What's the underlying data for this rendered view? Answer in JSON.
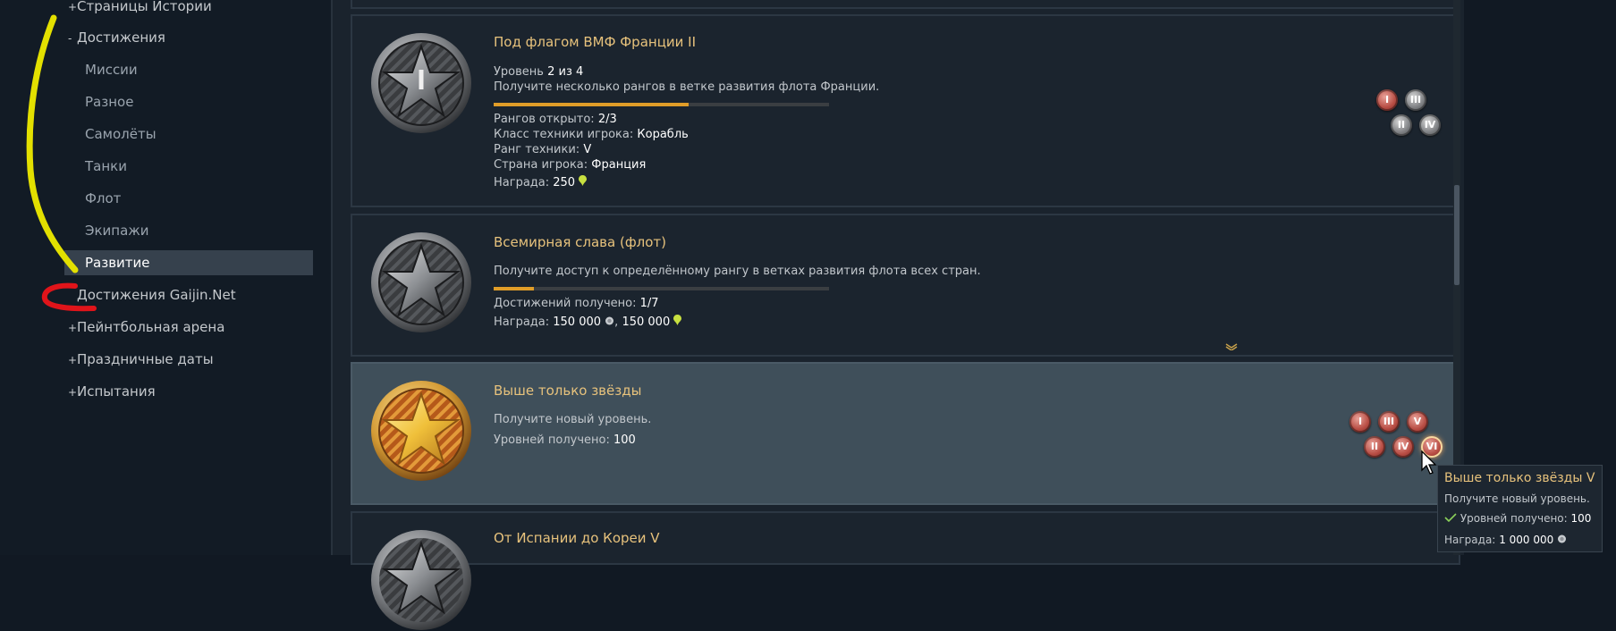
{
  "sidebar": {
    "items": [
      {
        "prefix": "+",
        "label": "Страницы Истории"
      },
      {
        "prefix": "-",
        "label": "Достижения"
      },
      {
        "label": "Миссии"
      },
      {
        "label": "Разное"
      },
      {
        "label": "Самолёты"
      },
      {
        "label": "Танки"
      },
      {
        "label": "Флот"
      },
      {
        "label": "Экипажи"
      },
      {
        "label": "Развитие"
      },
      {
        "label": "Достижения Gaijin.Net"
      },
      {
        "prefix": "+",
        "label": "Пейнтбольная арена"
      },
      {
        "prefix": "+",
        "label": "Праздничные даты"
      },
      {
        "prefix": "+",
        "label": "Испытания"
      }
    ],
    "active_index": 8
  },
  "cards": [
    {
      "title": "Под флагом ВМФ Франции II",
      "level_label": "Уровень",
      "level_value": "2 из 4",
      "description": "Получите несколько рангов в ветке развития флота Франции.",
      "progress": 0.58,
      "details": [
        {
          "label": "Рангов открыто:",
          "value": "2/3"
        },
        {
          "label": "Класс техники игрока:",
          "value": "Корабль"
        },
        {
          "label": "Ранг техники:",
          "value": "V"
        },
        {
          "label": "Страна игрока:",
          "value": "Франция"
        }
      ],
      "reward_label": "Награда:",
      "reward_value": "250",
      "ranks": [
        "I",
        "III",
        "II",
        "IV"
      ]
    },
    {
      "title": "Всемирная слава (флот)",
      "description": "Получите доступ к определённому рангу в ветках развития флота всех стран.",
      "progress": 0.12,
      "details": [
        {
          "label": "Достижений получено:",
          "value": "1/7"
        }
      ],
      "reward_label": "Награда:",
      "reward_value_1": "150 000",
      "reward_separator": ",",
      "reward_value_2": "150 000"
    },
    {
      "title": "Выше только звёзды",
      "description": "Получите новый уровень.",
      "details": [
        {
          "label": "Уровней получено:",
          "value": "100"
        }
      ],
      "ranks": [
        "I",
        "III",
        "V",
        "II",
        "IV",
        "VI"
      ]
    },
    {
      "title": "От Испании до Кореи V"
    }
  ],
  "tooltip": {
    "title": "Выше только звёзды V",
    "description": "Получите новый уровень.",
    "check_label": "Уровней получено:",
    "check_value": "100",
    "reward_label": "Награда:",
    "reward_value": "1 000 000"
  },
  "colors": {
    "title": "#e7c27c",
    "progress": "#e09d28",
    "selected_card": "#3f4f5a",
    "sidebar_active": "#36414d",
    "rank_red": "#b84d44",
    "rank_grey": "#7f8184"
  },
  "icons": {
    "medal_silver": "silver-star-medal-icon",
    "medal_gold": "gold-star-medal-icon",
    "currency_lions": "silver-lions-icon",
    "currency_rp": "research-points-icon",
    "check": "check-icon",
    "cursor": "mouse-cursor-icon",
    "chevron": "chevron-down-icon"
  }
}
